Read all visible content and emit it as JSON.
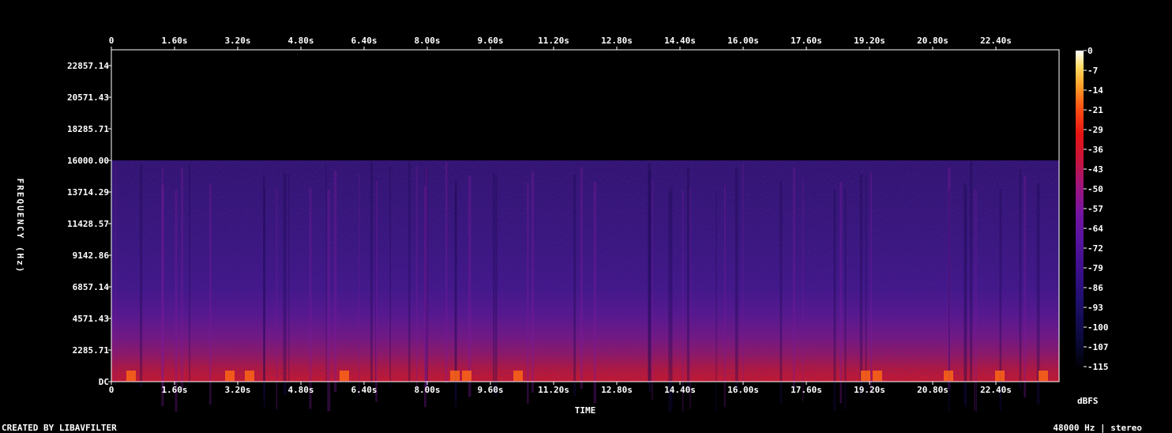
{
  "chart_data": {
    "type": "heatmap",
    "title": "",
    "xlabel": "TIME",
    "ylabel": "FREQUENCY (Hz)",
    "x_ticks": [
      "0",
      "1.60s",
      "3.20s",
      "4.80s",
      "6.40s",
      "8.00s",
      "9.60s",
      "11.20s",
      "12.80s",
      "14.40s",
      "16.00s",
      "17.60s",
      "19.20s",
      "20.80s",
      "22.40s"
    ],
    "x_tick_values": [
      0,
      1.6,
      3.2,
      4.8,
      6.4,
      8.0,
      9.6,
      11.2,
      12.8,
      14.4,
      16.0,
      17.6,
      19.2,
      20.8,
      22.4
    ],
    "xlim": [
      0,
      24
    ],
    "y_ticks": [
      "DC",
      "2285.71",
      "4571.43",
      "6857.14",
      "9142.86",
      "11428.57",
      "13714.29",
      "16000.00",
      "18285.71",
      "20571.43",
      "22857.14"
    ],
    "y_tick_values": [
      0,
      2285.71,
      4571.43,
      6857.14,
      9142.86,
      11428.57,
      13714.29,
      16000.0,
      18285.71,
      20571.43,
      22857.14
    ],
    "ylim": [
      0,
      24000
    ],
    "content_cutoff_hz": 16000,
    "colorbar": {
      "unit": "dBFS",
      "ticks": [
        "0",
        "-7",
        "-14",
        "-21",
        "-29",
        "-36",
        "-43",
        "-50",
        "-57",
        "-64",
        "-72",
        "-79",
        "-86",
        "-93",
        "-100",
        "-107",
        "-115"
      ],
      "range": [
        -120,
        0
      ],
      "colors": [
        "#000000",
        "#0a0a3a",
        "#1e0f6e",
        "#3c0f8c",
        "#5a14a0",
        "#7814a0",
        "#a0147a",
        "#c8143c",
        "#e61414",
        "#ff5014",
        "#ffa028",
        "#ffdc64",
        "#ffffff"
      ]
    },
    "bright_bursts_s": [
      0.5,
      3.0,
      3.5,
      5.9,
      8.7,
      9.0,
      10.3,
      19.1,
      19.4,
      21.2,
      22.5,
      23.6
    ]
  },
  "footer": {
    "left": "CREATED BY LIBAVFILTER",
    "right": "48000 Hz | stereo"
  }
}
